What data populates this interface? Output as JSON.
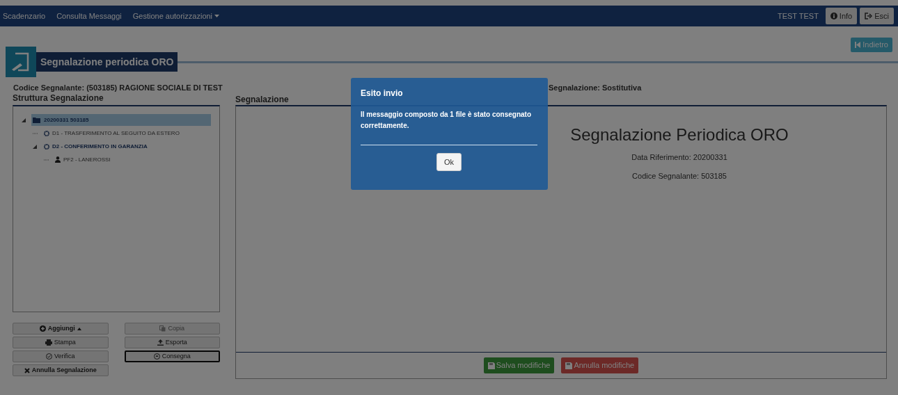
{
  "navbar": {
    "menu": [
      {
        "label": "Scadenzario",
        "dropdown": false
      },
      {
        "label": "Consulta Messaggi",
        "dropdown": false
      },
      {
        "label": "Gestione autorizzazioni",
        "dropdown": true
      }
    ],
    "user": "TEST TEST",
    "buttons": [
      {
        "kind": "info",
        "label": "Info"
      },
      {
        "kind": "exit",
        "label": "Esci"
      }
    ]
  },
  "back_button": "Indietro",
  "page_title": "Segnalazione periodica ORO",
  "codice_segnalante": "Codice Segnalante: (503185) RAGIONE SOCIALE DI TEST",
  "tipo_segnalazione": "Segnalazione: Sostitutiva",
  "structure": {
    "title": "Struttura Segnalazione",
    "tree": [
      {
        "label": "20200331 503185",
        "kind": "folder",
        "selected": true,
        "expanded": true,
        "children": [
          {
            "label": "D1 - TRASFERIMENTO AL SEGUITO DA ESTERO",
            "kind": "gear",
            "selected": false
          },
          {
            "label": "D2 - CONFERIMENTO IN GARANZIA",
            "kind": "gear",
            "selected": false,
            "expanded": true,
            "children": [
              {
                "label": "PF2 - LANEROSSI",
                "kind": "person",
                "selected": false
              }
            ]
          }
        ]
      }
    ]
  },
  "actions": [
    {
      "kind": "add",
      "label": "Aggiungi",
      "disabled": false,
      "focused": false
    },
    {
      "kind": "copy",
      "label": "Copia",
      "disabled": true,
      "focused": false
    },
    {
      "kind": "print",
      "label": "Stampa",
      "disabled": false,
      "focused": false
    },
    {
      "kind": "export",
      "label": "Esporta",
      "disabled": false,
      "focused": false
    },
    {
      "kind": "verify",
      "label": "Verifica",
      "disabled": false,
      "focused": false
    },
    {
      "kind": "deliver",
      "label": "Consegna",
      "disabled": false,
      "focused": true
    },
    {
      "kind": "cancel",
      "label": "Annulla Segnalazione",
      "disabled": false,
      "focused": false
    }
  ],
  "preview": {
    "title": "Segnalazione",
    "heading": "Segnalazione Periodica ORO",
    "lines": [
      "Data Riferimento: 20200331",
      "Codice Segnalante: 503185"
    ],
    "buttons": [
      {
        "kind": "save",
        "label": "Salva modifiche"
      },
      {
        "kind": "discard",
        "label": "Annulla modifiche"
      }
    ]
  },
  "dialog": {
    "title": "Esito invio",
    "message": "Il messaggio composto da 1 file è stato consegnato correttamente.",
    "button": "Ok"
  }
}
